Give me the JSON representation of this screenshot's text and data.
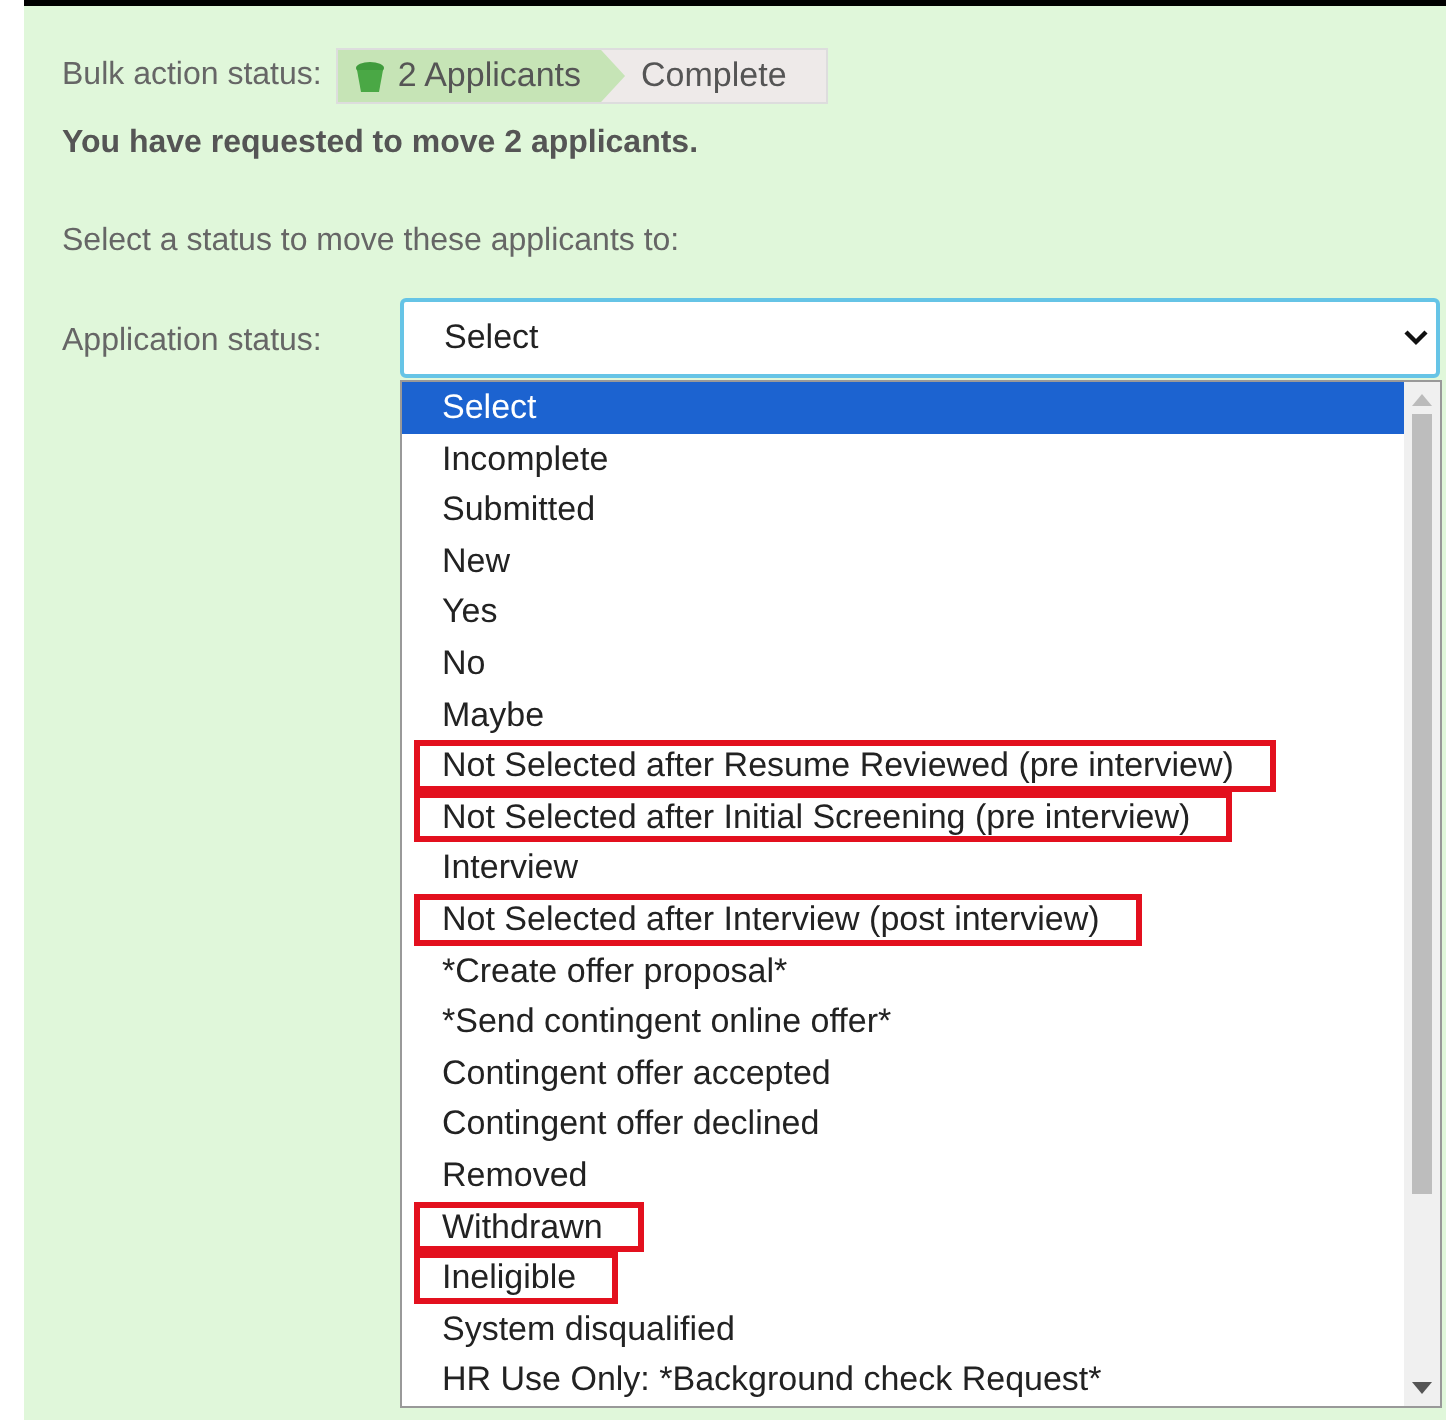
{
  "bulk_status": {
    "label": "Bulk action status:",
    "steps": [
      {
        "label": "2 Applicants",
        "selected": true
      },
      {
        "label": "Complete",
        "selected": false
      }
    ]
  },
  "request_message": "You have requested to move 2 applicants.",
  "instruction": "Select a status to move these applicants to:",
  "application_status": {
    "label": "Application status:",
    "value": "Select",
    "expanded": true,
    "options": [
      {
        "label": "Select",
        "selected": true,
        "highlighted": false
      },
      {
        "label": "Incomplete",
        "selected": false,
        "highlighted": false
      },
      {
        "label": "Submitted",
        "selected": false,
        "highlighted": false
      },
      {
        "label": "New",
        "selected": false,
        "highlighted": false
      },
      {
        "label": "Yes",
        "selected": false,
        "highlighted": false
      },
      {
        "label": "No",
        "selected": false,
        "highlighted": false
      },
      {
        "label": "Maybe",
        "selected": false,
        "highlighted": false
      },
      {
        "label": "Not Selected after Resume Reviewed (pre interview)",
        "selected": false,
        "highlighted": true
      },
      {
        "label": "Not Selected after Initial Screening (pre interview)",
        "selected": false,
        "highlighted": true
      },
      {
        "label": "Interview",
        "selected": false,
        "highlighted": false
      },
      {
        "label": "Not Selected after Interview (post interview)",
        "selected": false,
        "highlighted": true
      },
      {
        "label": "*Create offer proposal*",
        "selected": false,
        "highlighted": false
      },
      {
        "label": "*Send contingent online offer*",
        "selected": false,
        "highlighted": false
      },
      {
        "label": "Contingent offer accepted",
        "selected": false,
        "highlighted": false
      },
      {
        "label": "Contingent offer declined",
        "selected": false,
        "highlighted": false
      },
      {
        "label": "Removed",
        "selected": false,
        "highlighted": false
      },
      {
        "label": "Withdrawn",
        "selected": false,
        "highlighted": true
      },
      {
        "label": "Ineligible",
        "selected": false,
        "highlighted": true
      },
      {
        "label": "System disqualified",
        "selected": false,
        "highlighted": false
      },
      {
        "label": "HR Use Only: *Background check Request*",
        "selected": false,
        "highlighted": false
      }
    ]
  }
}
